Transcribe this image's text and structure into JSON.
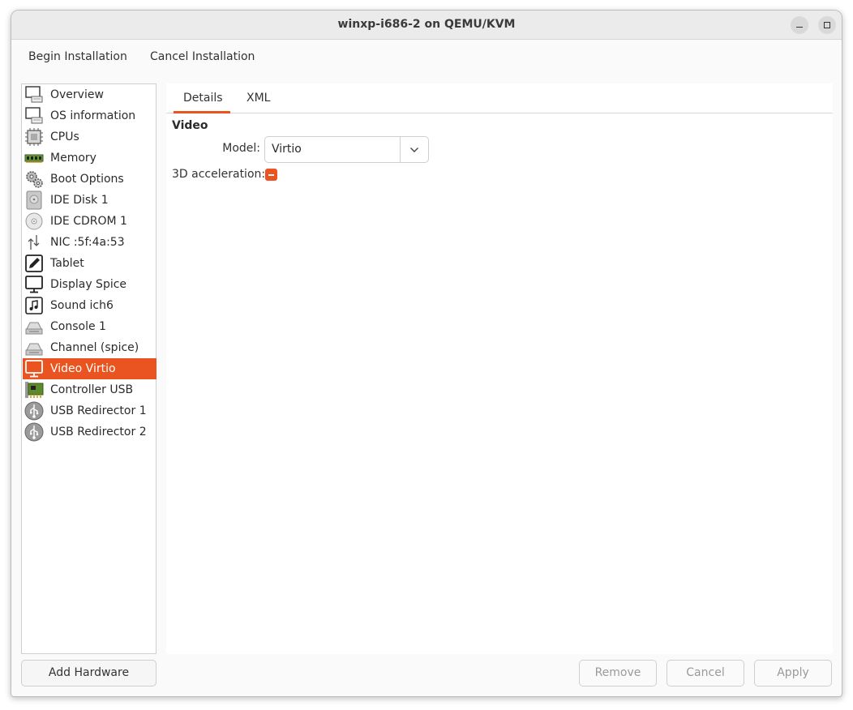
{
  "window": {
    "title": "winxp-i686-2 on QEMU/KVM"
  },
  "toolbar": {
    "begin_label": "Begin Installation",
    "cancel_label": "Cancel Installation"
  },
  "sidebar": {
    "selected_index": 13,
    "items": [
      {
        "label": "Overview",
        "icon": "monitor-keyboard-icon"
      },
      {
        "label": "OS information",
        "icon": "monitor-keyboard-icon"
      },
      {
        "label": "CPUs",
        "icon": "cpu-chip-icon"
      },
      {
        "label": "Memory",
        "icon": "memory-ram-icon"
      },
      {
        "label": "Boot Options",
        "icon": "gears-icon"
      },
      {
        "label": "IDE Disk 1",
        "icon": "hard-disk-icon"
      },
      {
        "label": "IDE CDROM 1",
        "icon": "cdrom-icon"
      },
      {
        "label": "NIC :5f:4a:53",
        "icon": "network-arrows-icon"
      },
      {
        "label": "Tablet",
        "icon": "tablet-pen-icon"
      },
      {
        "label": "Display Spice",
        "icon": "display-monitor-icon"
      },
      {
        "label": "Sound ich6",
        "icon": "music-note-icon"
      },
      {
        "label": "Console 1",
        "icon": "serial-port-icon"
      },
      {
        "label": "Channel (spice)",
        "icon": "serial-port-icon"
      },
      {
        "label": "Video Virtio",
        "icon": "video-monitor-icon"
      },
      {
        "label": "Controller USB",
        "icon": "controller-card-icon"
      },
      {
        "label": "USB Redirector 1",
        "icon": "usb-icon"
      },
      {
        "label": "USB Redirector 2",
        "icon": "usb-icon"
      }
    ],
    "add_hardware_label": "Add Hardware"
  },
  "main": {
    "tabs": [
      {
        "label": "Details",
        "active": true
      },
      {
        "label": "XML",
        "active": false
      }
    ],
    "section_title": "Video",
    "model_label": "Model:",
    "model_value": "Virtio",
    "accel_label": "3D acceleration:",
    "accel_state": "mixed"
  },
  "buttons": {
    "remove_label": "Remove",
    "cancel_label": "Cancel",
    "apply_label": "Apply"
  },
  "colors": {
    "accent": "#e95420"
  }
}
